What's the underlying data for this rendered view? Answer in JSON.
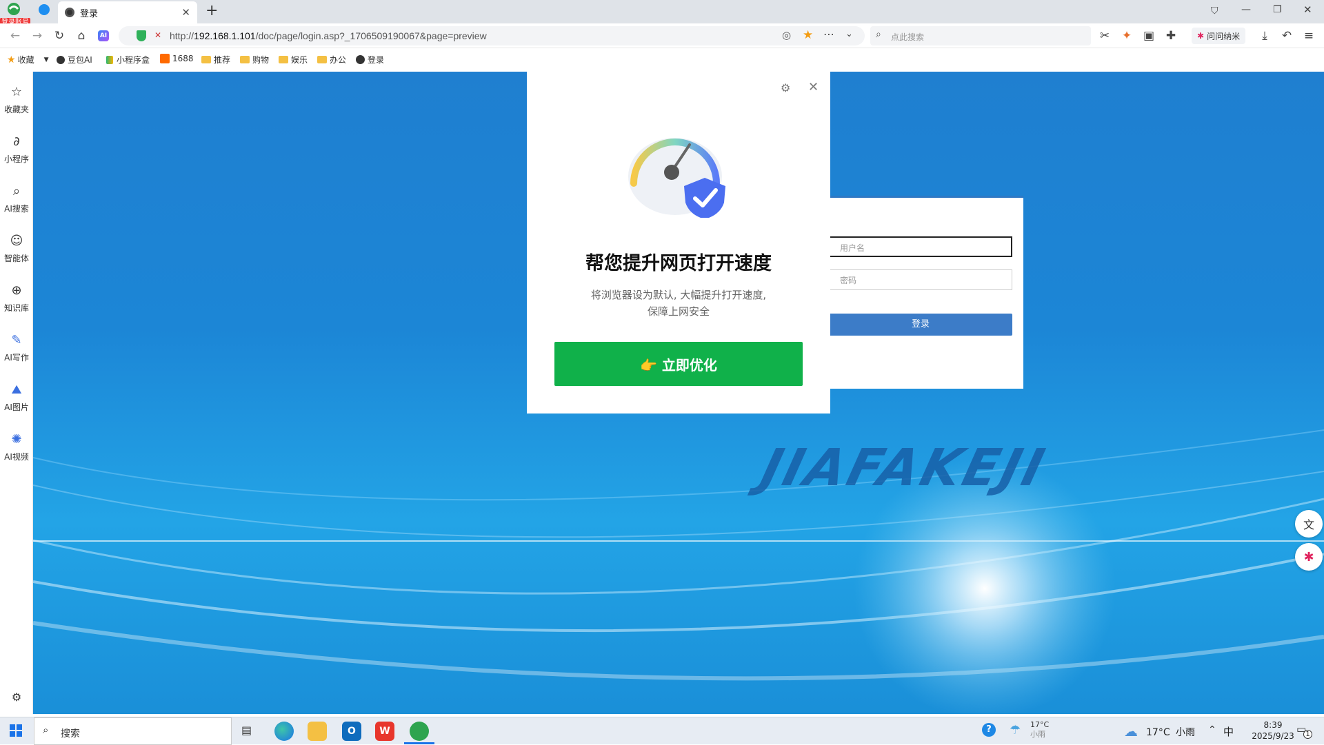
{
  "browser": {
    "account_badge": "登录账号",
    "tab_title": "登录",
    "url_prefix": "http://",
    "url_host": "192.168.1.101",
    "url_path": "/doc/page/login.asp?_1706509190067&page=preview",
    "search_placeholder": "点此搜索",
    "wenwen_label": "问问纳米"
  },
  "bookmarks": [
    {
      "label": "收藏",
      "icon": "star-icon"
    },
    {
      "label": "豆包AI",
      "icon": "doubao-icon"
    },
    {
      "label": "小程序盒",
      "icon": "miniapp-icon"
    },
    {
      "label": "1688",
      "icon": "1688-icon"
    },
    {
      "label": "推荐",
      "icon": "folder-icon"
    },
    {
      "label": "购物",
      "icon": "folder-icon"
    },
    {
      "label": "娱乐",
      "icon": "folder-icon"
    },
    {
      "label": "办公",
      "icon": "folder-icon"
    },
    {
      "label": "登录",
      "icon": "site-icon"
    }
  ],
  "sidebar": {
    "items": [
      {
        "label": "收藏夹",
        "icon": "star-outline-icon"
      },
      {
        "label": "小程序",
        "icon": "link-icon"
      },
      {
        "label": "AI搜索",
        "icon": "search-icon"
      },
      {
        "label": "智能体",
        "icon": "bot-icon"
      },
      {
        "label": "知识库",
        "icon": "knowledge-icon"
      },
      {
        "label": "AI写作",
        "icon": "write-icon"
      },
      {
        "label": "AI图片",
        "icon": "image-icon"
      },
      {
        "label": "AI视频",
        "icon": "video-icon"
      }
    ]
  },
  "login": {
    "username_placeholder": "用户名",
    "password_placeholder": "密码",
    "submit_label": "登录",
    "watermark": "JIAFAKEJI"
  },
  "modal": {
    "title": "帮您提升网页打开速度",
    "desc_line1": "将浏览器设为默认, 大幅提升打开速度,",
    "desc_line2": "保障上网安全",
    "button_label": "👉 立即优化"
  },
  "taskbar": {
    "search_label": "搜索",
    "weather_small_temp": "17°C",
    "weather_small_cond": "小雨",
    "weather_temp": "17°C",
    "weather_cond": "小雨",
    "ime": "中",
    "time": "8:39",
    "date": "2025/9/23",
    "notif_count": "1"
  },
  "colors": {
    "accent_green": "#10b14a",
    "login_blue": "#3c7cc8",
    "page_blue": "#1f7fd0"
  }
}
